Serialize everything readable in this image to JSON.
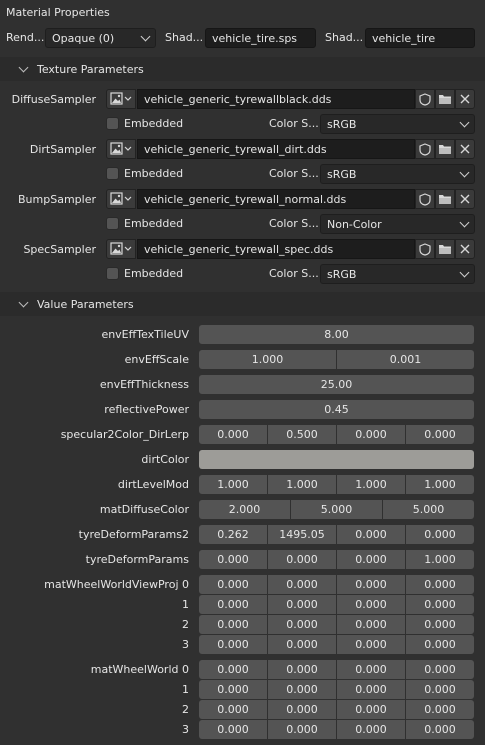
{
  "panel_title": "Material Properties",
  "top": {
    "render_label": "Rend...",
    "render_value": "Opaque (0)",
    "shader_label": "Shad...",
    "shader_file": "vehicle_tire.sps",
    "shader2_label": "Shad...",
    "shader_name": "vehicle_tire"
  },
  "texture_section": {
    "title": "Texture Parameters",
    "embedded_label": "Embedded",
    "colorspace_label": "Color S...",
    "samplers": [
      {
        "name": "DiffuseSampler",
        "file": "vehicle_generic_tyrewallblack.dds",
        "colorspace": "sRGB"
      },
      {
        "name": "DirtSampler",
        "file": "vehicle_generic_tyrewall_dirt.dds",
        "colorspace": "sRGB"
      },
      {
        "name": "BumpSampler",
        "file": "vehicle_generic_tyrewall_normal.dds",
        "colorspace": "Non-Color"
      },
      {
        "name": "SpecSampler",
        "file": "vehicle_generic_tyrewall_spec.dds",
        "colorspace": "sRGB"
      }
    ]
  },
  "value_section": {
    "title": "Value Parameters",
    "envEffTexTileUV": {
      "label": "envEffTexTileUV",
      "value": "8.00"
    },
    "envEffScale": {
      "label": "envEffScale",
      "v1": "1.000",
      "v2": "0.001"
    },
    "envEffThickness": {
      "label": "envEffThickness",
      "value": "25.00"
    },
    "reflectivePower": {
      "label": "reflectivePower",
      "value": "0.45"
    },
    "specular2Color": {
      "label": "specular2Color_DirLerp",
      "values": [
        "0.000",
        "0.500",
        "0.000",
        "0.000"
      ]
    },
    "dirtColor": {
      "label": "dirtColor",
      "color": "#9d9c98"
    },
    "dirtLevelMod": {
      "label": "dirtLevelMod",
      "values": [
        "1.000",
        "1.000",
        "1.000",
        "1.000"
      ]
    },
    "matDiffuseColor": {
      "label": "matDiffuseColor",
      "values": [
        "2.000",
        "5.000",
        "5.000"
      ]
    },
    "tyreDeformParams2": {
      "label": "tyreDeformParams2",
      "values": [
        "0.262",
        "1495.05",
        "0.000",
        "0.000"
      ]
    },
    "tyreDeformParams": {
      "label": "tyreDeformParams",
      "values": [
        "0.000",
        "0.000",
        "0.000",
        "1.000"
      ]
    },
    "matWheelWorldViewProj": {
      "label": "matWheelWorldViewProj 0",
      "rows": [
        {
          "idx": "",
          "values": [
            "0.000",
            "0.000",
            "0.000",
            "0.000"
          ]
        },
        {
          "idx": "1",
          "values": [
            "0.000",
            "0.000",
            "0.000",
            "0.000"
          ]
        },
        {
          "idx": "2",
          "values": [
            "0.000",
            "0.000",
            "0.000",
            "0.000"
          ]
        },
        {
          "idx": "3",
          "values": [
            "0.000",
            "0.000",
            "0.000",
            "0.000"
          ]
        }
      ]
    },
    "matWheelWorld": {
      "label": "matWheelWorld 0",
      "rows": [
        {
          "idx": "",
          "values": [
            "0.000",
            "0.000",
            "0.000",
            "0.000"
          ]
        },
        {
          "idx": "1",
          "values": [
            "0.000",
            "0.000",
            "0.000",
            "0.000"
          ]
        },
        {
          "idx": "2",
          "values": [
            "0.000",
            "0.000",
            "0.000",
            "0.000"
          ]
        },
        {
          "idx": "3",
          "values": [
            "0.000",
            "0.000",
            "0.000",
            "0.000"
          ]
        }
      ]
    }
  }
}
